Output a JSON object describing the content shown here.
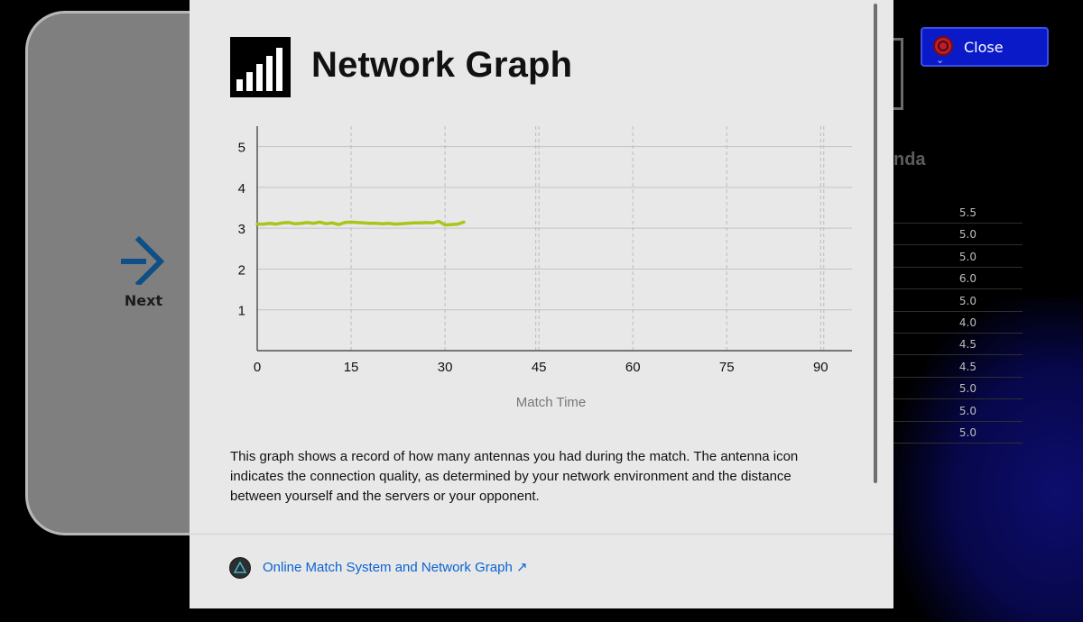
{
  "background": {
    "next_label": "Next",
    "right_heading": "nda",
    "stat_values": [
      "5.5",
      "5.0",
      "5.0",
      "6.0",
      "5.0",
      "4.0",
      "4.5",
      "4.5",
      "5.0",
      "5.0",
      "5.0"
    ]
  },
  "close_button": {
    "label": "Close",
    "icon": "circle-button-icon"
  },
  "modal": {
    "title": "Network Graph",
    "title_icon": "antenna-bars-icon",
    "description": "This graph shows a record of how many antennas you had during the match. The antenna icon indicates the connection quality, as determined by your network environment and the distance between yourself and the servers or your opponent.",
    "link": {
      "icon": "triangle-button-icon",
      "label": "Online Match System and Network Graph ↗"
    }
  },
  "chart_data": {
    "type": "line",
    "xlabel": "Match Time",
    "ylabel": "",
    "x_ticks": [
      0,
      15,
      30,
      45,
      60,
      75,
      90
    ],
    "y_ticks": [
      1,
      2,
      3,
      4,
      5
    ],
    "xlim": [
      0,
      95
    ],
    "ylim": [
      0,
      5.5
    ],
    "vertical_dashed_lines": [
      15,
      30,
      44.5,
      45,
      60,
      75,
      90,
      90.5
    ],
    "grid": "horizontal",
    "line_color": "#a6c71a",
    "series": [
      {
        "x": [
          0,
          1,
          2,
          3,
          4,
          5,
          6,
          7,
          8,
          9,
          10,
          11,
          12,
          13,
          14,
          15,
          16,
          17,
          18,
          19,
          20,
          21,
          22,
          23,
          24,
          25,
          26,
          27,
          28,
          29,
          30,
          31,
          32,
          33
        ],
        "values": [
          3.1,
          3.1,
          3.12,
          3.1,
          3.13,
          3.14,
          3.11,
          3.12,
          3.14,
          3.12,
          3.15,
          3.11,
          3.13,
          3.09,
          3.14,
          3.15,
          3.14,
          3.13,
          3.12,
          3.12,
          3.11,
          3.12,
          3.1,
          3.11,
          3.12,
          3.13,
          3.13,
          3.14,
          3.13,
          3.17,
          3.08,
          3.09,
          3.1,
          3.15
        ]
      }
    ]
  }
}
